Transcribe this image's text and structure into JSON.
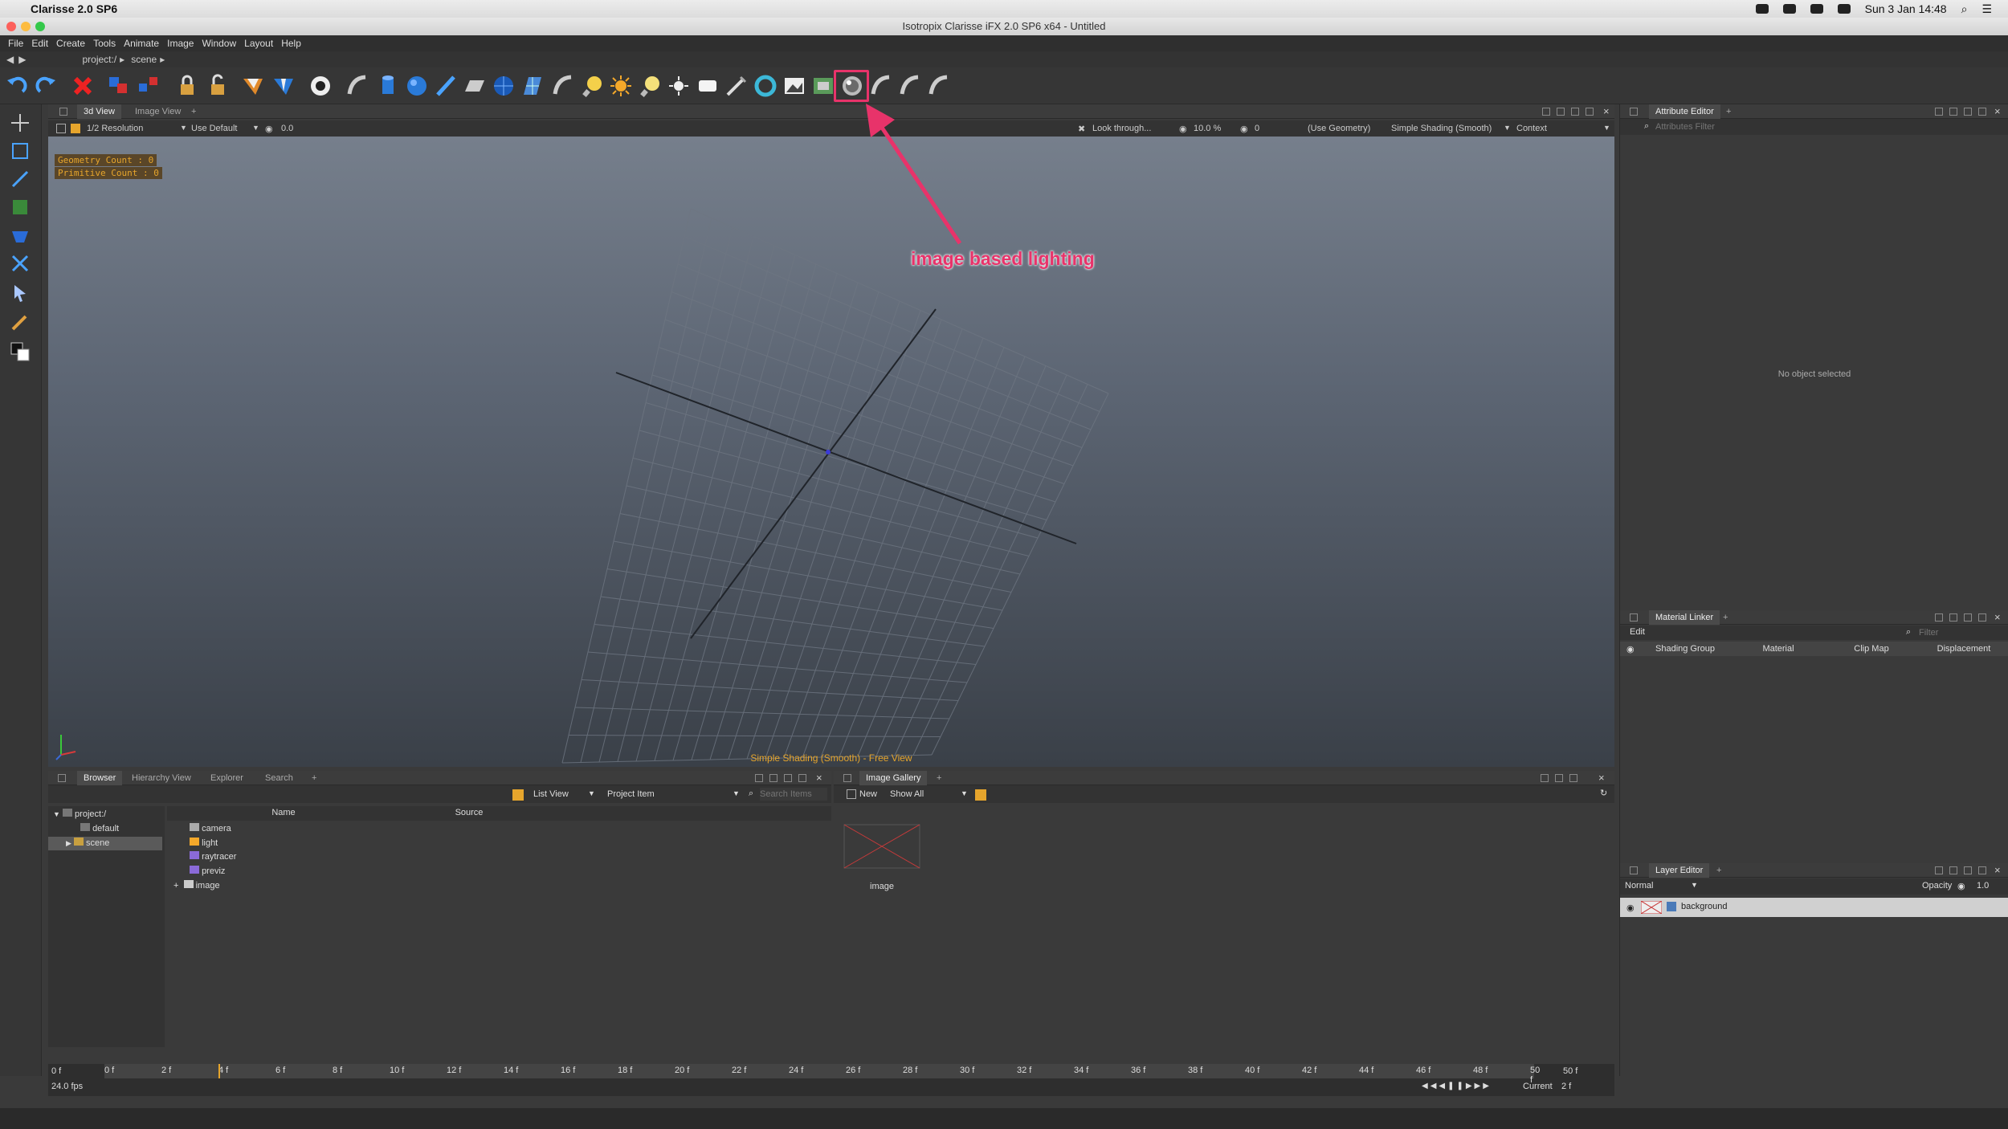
{
  "mac_menu": {
    "app_name": "Clarisse 2.0 SP6",
    "datetime": "Sun 3 Jan 14:48"
  },
  "window": {
    "title": "Isotropix Clarisse iFX 2.0 SP6 x64  - Untitled"
  },
  "menu": [
    "File",
    "Edit",
    "Create",
    "Tools",
    "Animate",
    "Image",
    "Window",
    "Layout",
    "Help"
  ],
  "path": {
    "segments": [
      "project:/",
      "scene"
    ]
  },
  "viewport": {
    "tabs": [
      "3d View",
      "Image View"
    ],
    "resolution": "1/2 Resolution",
    "lod": "Use Default",
    "value": "0.0",
    "look_through": "Look through...",
    "zoom": "10.0 %",
    "zoom2": "0",
    "use_geometry": "(Use Geometry)",
    "shading": "Simple Shading (Smooth)",
    "context": "Context",
    "geometry_count": "Geometry Count : 0",
    "primitive_count": "Primitive Count : 0",
    "footer": "Simple Shading (Smooth) - Free View"
  },
  "annotation": {
    "text": "image based lighting",
    "color": "#e8336a"
  },
  "browser": {
    "tabs": [
      "Browser",
      "Hierarchy View",
      "Explorer",
      "Search"
    ],
    "view_mode": "List View",
    "filter": "Project Item",
    "search_placeholder": "Search Items",
    "tree": [
      "project:/",
      "default",
      "scene"
    ],
    "columns": [
      "Name",
      "Source"
    ],
    "items": [
      "camera",
      "light",
      "raytracer",
      "previz",
      "image"
    ]
  },
  "gallery": {
    "tab": "Image Gallery",
    "new_label": "New",
    "show": "Show All",
    "thumb_label": "image"
  },
  "attribute_editor": {
    "tab": "Attribute Editor",
    "filter_placeholder": "Attributes Filter",
    "empty": "No object selected"
  },
  "material_linker": {
    "tab": "Material Linker",
    "edit": "Edit",
    "filter_placeholder": "Filter",
    "columns": [
      "Shading Group",
      "Material",
      "Clip Map",
      "Displacement"
    ]
  },
  "layer_editor": {
    "tab": "Layer Editor",
    "blend": "Normal",
    "opacity_label": "Opacity",
    "opacity": "1.0",
    "layer": "background"
  },
  "timeline": {
    "start": "0 f",
    "end": "50 f",
    "ticks": [
      "0 f",
      "2 f",
      "4 f",
      "6 f",
      "8 f",
      "10 f",
      "12 f",
      "14 f",
      "16 f",
      "18 f",
      "20 f",
      "22 f",
      "24 f",
      "26 f",
      "28 f",
      "30 f",
      "32 f",
      "34 f",
      "36 f",
      "38 f",
      "40 f",
      "42 f",
      "44 f",
      "46 f",
      "48 f",
      "50 f"
    ],
    "fps": "24.0 fps",
    "current_label": "Current",
    "current": "2 f"
  }
}
